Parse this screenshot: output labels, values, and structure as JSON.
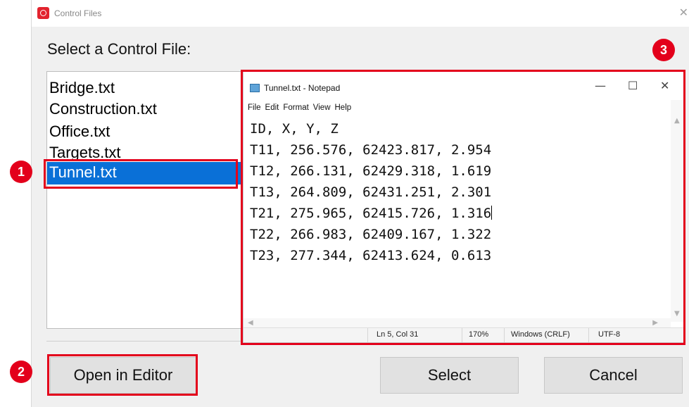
{
  "dialog": {
    "title": "Control Files",
    "close_icon": "close-icon",
    "prompt": "Select a Control File:",
    "files": [
      {
        "name": "Bridge.txt",
        "selected": false
      },
      {
        "name": "Construction.txt",
        "selected": false
      },
      {
        "name": "Office.txt",
        "selected": false
      },
      {
        "name": "Targets.txt",
        "selected": false
      },
      {
        "name": "Tunnel.txt",
        "selected": true
      }
    ],
    "buttons": {
      "open_in_editor": "Open in Editor",
      "select": "Select",
      "cancel": "Cancel"
    }
  },
  "notepad": {
    "title": "Tunnel.txt - Notepad",
    "controls": {
      "minimize": "—",
      "maximize": "☐",
      "close": "✕"
    },
    "menu": [
      "File",
      "Edit",
      "Format",
      "View",
      "Help"
    ],
    "lines": [
      "ID, X, Y, Z",
      "T11, 256.576, 62423.817, 2.954",
      "T12, 266.131, 62429.318, 1.619",
      "T13, 264.809, 62431.251, 2.301",
      "T21, 275.965, 62415.726, 1.316",
      "T22, 266.983, 62409.167, 1.322",
      "T23, 277.344, 62413.624, 0.613"
    ],
    "status": {
      "position": "Ln 5, Col 31",
      "zoom": "170%",
      "line_ending": "Windows (CRLF)",
      "encoding": "UTF-8"
    }
  },
  "annotations": {
    "markers": [
      "1",
      "2",
      "3"
    ],
    "color": "#e3001b"
  },
  "colors": {
    "selection": "#0a70d7",
    "dialog_bg": "#f0f0f0",
    "button_bg": "#e1e1e1"
  }
}
